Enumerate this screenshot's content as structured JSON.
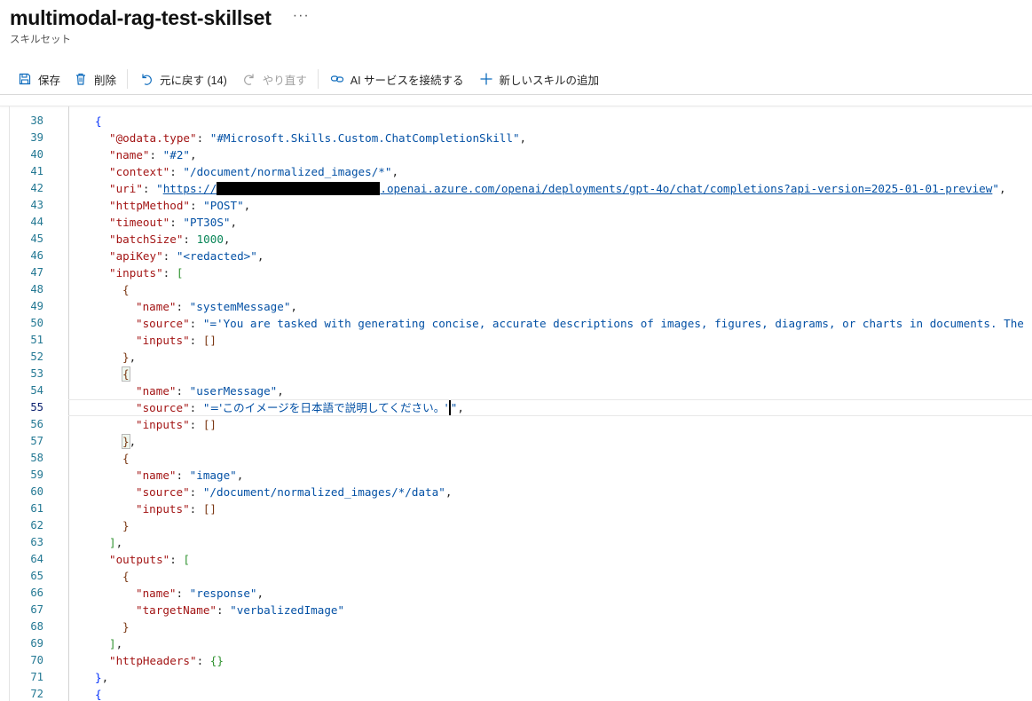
{
  "header": {
    "title": "multimodal-rag-test-skillset",
    "more": "···",
    "subtitle": "スキルセット"
  },
  "toolbar": {
    "save": "保存",
    "delete": "削除",
    "undo": "元に戻す (14)",
    "redo": "やり直す",
    "connect_ai": "AI サービスを接続する",
    "add_skill": "新しいスキルの追加"
  },
  "editor": {
    "active_line": 55,
    "line_numbers": [
      "38",
      "39",
      "40",
      "41",
      "42",
      "43",
      "44",
      "45",
      "46",
      "47",
      "48",
      "49",
      "50",
      "51",
      "52",
      "53",
      "54",
      "55",
      "56",
      "57",
      "58",
      "59",
      "60",
      "61",
      "62",
      "63",
      "64",
      "65",
      "66",
      "67",
      "68",
      "69",
      "70",
      "71",
      "72"
    ],
    "uri_prefix": "https://",
    "uri_suffix": ".openai.azure.com/openai/deployments/gpt-4o/chat/completions?api-version=2025-01-01-preview",
    "system_message_visible": "='You are tasked with generating concise, accurate descriptions of images, figures, diagrams, or charts in documents. The",
    "user_message_visible": "='このイメージを日本語で説明してください。'"
  }
}
